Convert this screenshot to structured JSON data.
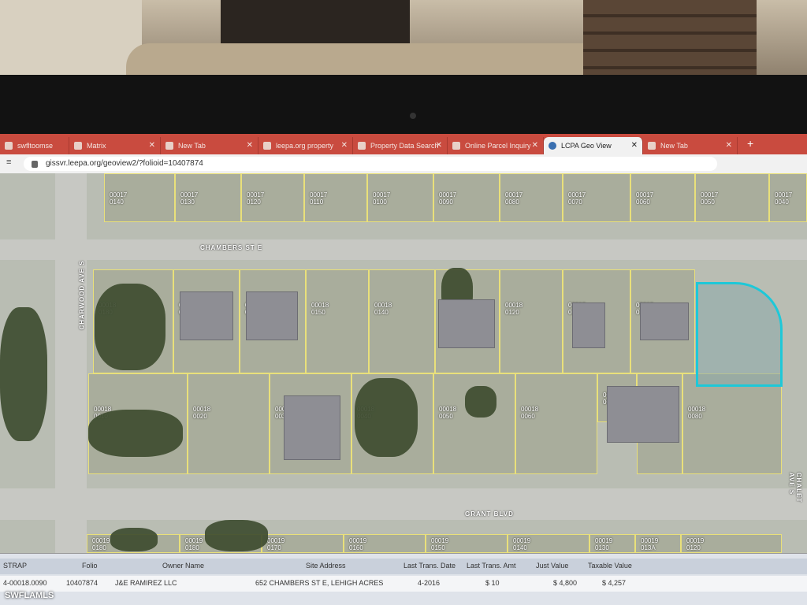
{
  "tabs": [
    {
      "label": "swfltoomse"
    },
    {
      "label": "Matrix"
    },
    {
      "label": "New Tab"
    },
    {
      "label": "leepa.org property"
    },
    {
      "label": "Property Data Search"
    },
    {
      "label": "Online Parcel Inquiry"
    },
    {
      "label": "LCPA Geo View"
    },
    {
      "label": "New Tab"
    }
  ],
  "url": "gissvr.leepa.org/geoview2/?folioid=10407874",
  "streets": {
    "chambers": "CHAMBERS ST E",
    "charwood": "CHARWOOD AVE S",
    "grant": "GRANT BLVD",
    "chalet": "CHALET AVE S"
  },
  "lots": {
    "r1_1": "00017\n0140",
    "r1_2": "00017\n0130",
    "r1_3": "00017\n0120",
    "r1_4": "00017\n0110",
    "r1_5": "00017\n0100",
    "r1_6": "00017\n0090",
    "r1_7": "00017\n0080",
    "r1_8": "00017\n0070",
    "r1_9": "00017\n0060",
    "r1_10": "00017\n0050",
    "r1_11": "00017\n0040",
    "a1": "00018\n0180",
    "a2": "00018\n0170",
    "a3": "00018\n0160",
    "a4": "00018\n0150",
    "a5": "00018\n0140",
    "a6": "00018\n0130",
    "a7": "00018\n0120",
    "a8": "00018\n0110",
    "a9": "00018\n0100",
    "a10": "00018\n0090",
    "b1": "00018\n0010",
    "b2": "00018\n0020",
    "b3": "00018\n0030",
    "b4": "00018\n0040",
    "b5": "00018\n0050",
    "b6": "00018\n0060",
    "b7": "00018\n0070",
    "b8": "00018\n007A",
    "b9": "00018\n0080",
    "c1": "00019\n0180",
    "c2": "00019\n0180",
    "c3": "00019\n0170",
    "c4": "00019\n0160",
    "c5": "00019\n0150",
    "c6": "00019\n0140",
    "c7": "00019\n0130",
    "c8": "00019\n013A",
    "c9": "00019\n0120"
  },
  "grid": {
    "headers": [
      "STRAP",
      "Folio",
      "Owner Name",
      "Site Address",
      "Last Trans. Date",
      "Last Trans. Amt",
      "Just Value",
      "Taxable Value"
    ],
    "row": [
      "4-00018.0090",
      "10407874",
      "J&E RAMIREZ LLC",
      "652 CHAMBERS ST E, LEHIGH ACRES",
      "4-2016",
      "$ 10",
      "$ 4,800",
      "$ 4,257"
    ]
  },
  "watermark": "SWFLAMLS",
  "colors": {
    "tabbar": "#c94b3f",
    "selection": "#1ec8d8",
    "lotline": "#e9e07a"
  }
}
